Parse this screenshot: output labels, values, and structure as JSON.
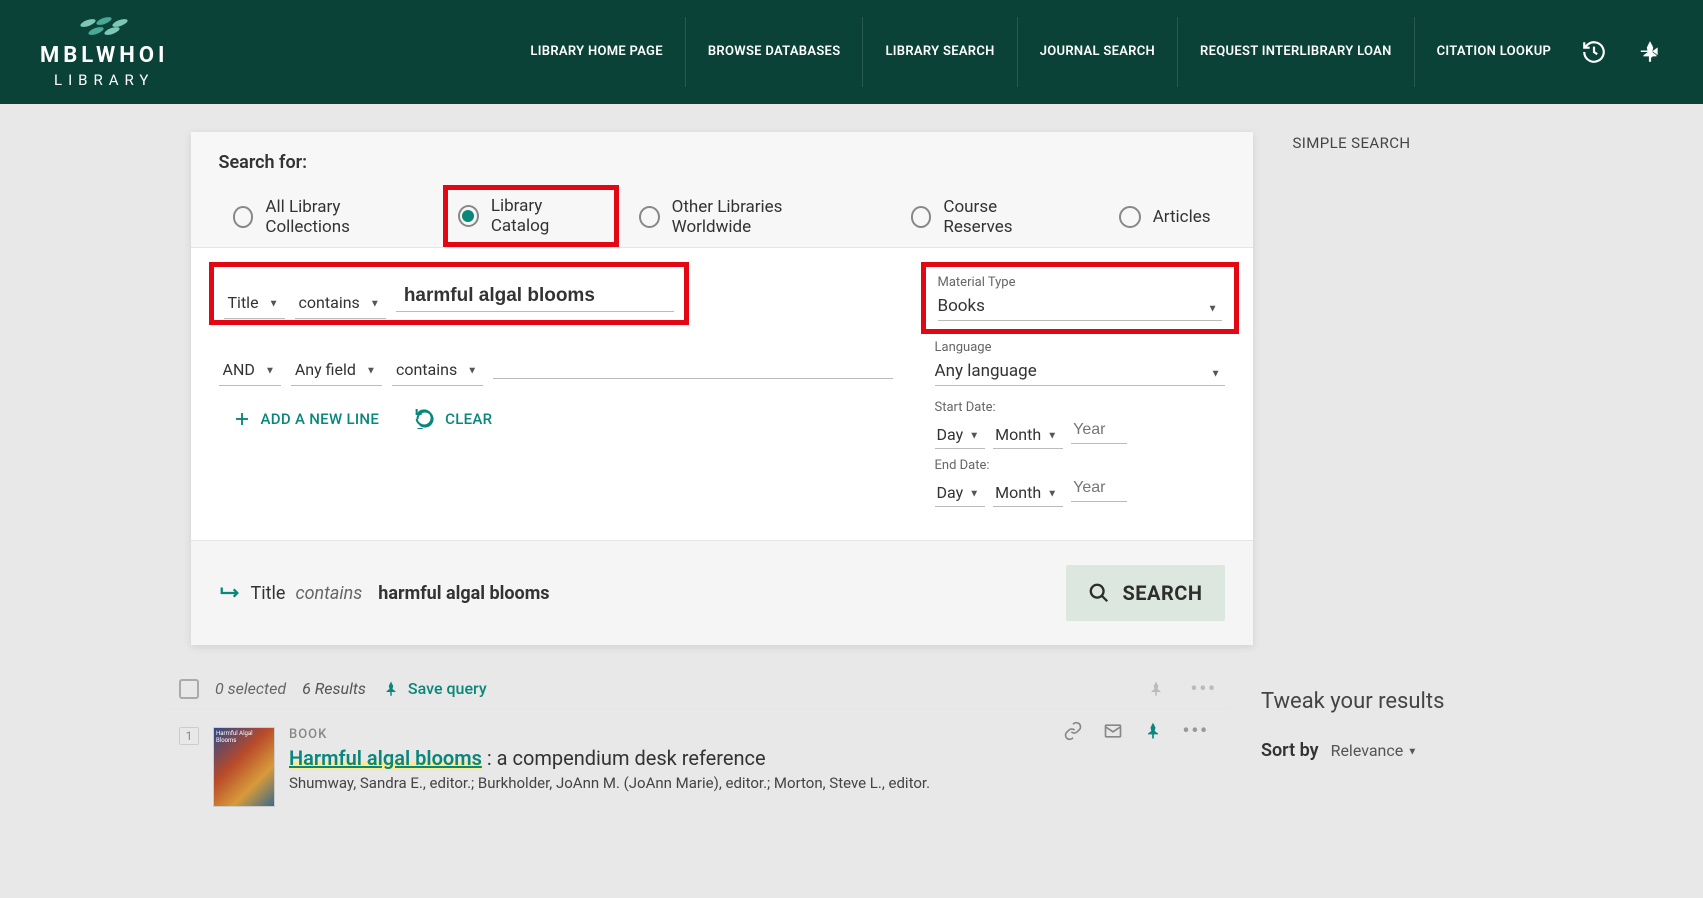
{
  "header": {
    "logo_main": "MBLWHOI",
    "logo_sub": "LIBRARY",
    "nav": [
      "LIBRARY HOME PAGE",
      "BROWSE DATABASES",
      "LIBRARY SEARCH",
      "JOURNAL SEARCH",
      "REQUEST INTERLIBRARY LOAN",
      "CITATION LOOKUP"
    ]
  },
  "search": {
    "search_for_label": "Search for:",
    "scopes": {
      "all": "All Library Collections",
      "catalog": "Library Catalog",
      "worldwide": "Other Libraries Worldwide",
      "reserves": "Course Reserves",
      "articles": "Articles"
    },
    "row1": {
      "field": "Title",
      "op": "contains",
      "value": "harmful algal blooms"
    },
    "row2": {
      "bool": "AND",
      "field": "Any field",
      "op": "contains"
    },
    "add_line": "ADD A NEW LINE",
    "clear": "CLEAR",
    "filters": {
      "material_label": "Material Type",
      "material_value": "Books",
      "language_label": "Language",
      "language_value": "Any language",
      "start_label": "Start Date:",
      "end_label": "End Date:",
      "day": "Day",
      "month": "Month",
      "year_placeholder": "Year"
    },
    "summary": {
      "field": "Title",
      "op": "contains",
      "value": "harmful algal blooms"
    },
    "search_button": "SEARCH"
  },
  "simple_search": "SIMPLE SEARCH",
  "results_bar": {
    "selected": "0 selected",
    "count": "6 Results",
    "save_query": "Save query"
  },
  "result1": {
    "num": "1",
    "type": "BOOK",
    "title_hl": "Harmful algal blooms",
    "title_rest": " : a compendium desk reference",
    "authors": "Shumway, Sandra E., editor.; Burkholder, JoAnn M. (JoAnn Marie), editor.; Morton, Steve L., editor."
  },
  "tweak": {
    "title": "Tweak your results",
    "sortby_label": "Sort by",
    "sortby_value": "Relevance"
  }
}
